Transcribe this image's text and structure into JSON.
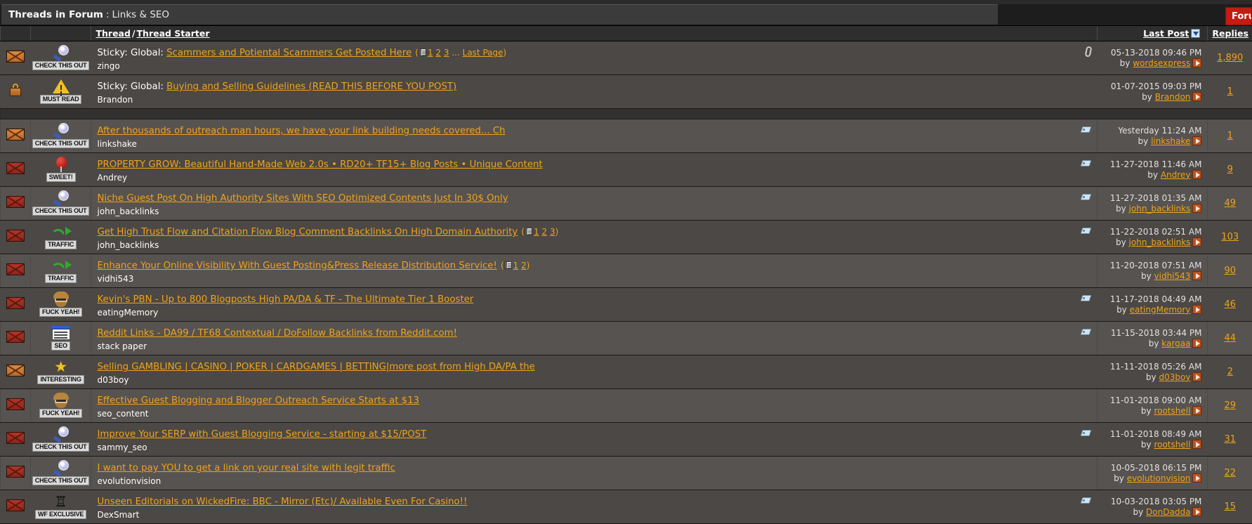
{
  "header": {
    "title_label": "Threads in Forum",
    "separator": ":",
    "forum_name": "Links & SEO",
    "forum_tools_label": "Forum Tools"
  },
  "columns": {
    "thread": "Thread",
    "slash": "/",
    "thread_starter": "Thread Starter",
    "last_post": "Last Post",
    "replies": "Replies"
  },
  "colors": {
    "link": "#f0a31a",
    "text": "#ffffff",
    "row_dark": "#4b4845",
    "row_light": "#565350",
    "header_bar": "#3b3b3b",
    "accent_button": "#c41b12"
  },
  "sticky_rows": [
    {
      "status_icon": "unread-envelope-orange-icon",
      "prefix_icon": "magnifier-icon",
      "prefix_caption": "CHECK THIS OUT",
      "sticky_label": "Sticky: Global:",
      "title": "Scammers and Potiental Scammers Get Posted Here",
      "pages": [
        "1",
        "2",
        "3"
      ],
      "pages_ellipsis": "...",
      "last_page_label": "Last Page",
      "starter": "zingo",
      "has_attachment": true,
      "has_tag": false,
      "last_post_date": "05-13-2018 09:46 PM",
      "last_post_by_prefix": "by",
      "last_post_by": "wordsexpress",
      "replies": "1,890",
      "shade": "dark"
    },
    {
      "status_icon": "locked-envelope-icon",
      "prefix_icon": "warning-triangle-icon",
      "prefix_caption": "MUST READ",
      "sticky_label": "Sticky: Global:",
      "title": "Buying and Selling Guidelines (READ THIS BEFORE YOU POST)",
      "pages": [],
      "pages_ellipsis": "",
      "last_page_label": "",
      "starter": "Brandon",
      "has_attachment": false,
      "has_tag": false,
      "last_post_date": "01-07-2015 09:03 PM",
      "last_post_by_prefix": "by",
      "last_post_by": "Brandon",
      "replies": "1",
      "shade": "dark"
    }
  ],
  "thread_rows": [
    {
      "status_icon": "unread-envelope-orange-icon",
      "prefix_icon": "magnifier-icon",
      "prefix_caption": "CHECK THIS OUT",
      "title": "After thousands of outreach man hours, we have your link building needs covered... Ch",
      "pages": [],
      "starter": "linkshake",
      "has_tag": true,
      "last_post_date": "Yesterday 11:24 AM",
      "last_post_by_prefix": "by",
      "last_post_by": "linkshake",
      "replies": "1",
      "shade": "light"
    },
    {
      "status_icon": "unread-envelope-red-icon",
      "prefix_icon": "lollipop-icon",
      "prefix_caption": "SWEET!",
      "title": "PROPERTY GROW: Beautiful Hand-Made Web 2.0s • RD20+ TF15+ Blog Posts • Unique Content",
      "pages": [],
      "starter": "Andrey",
      "has_tag": true,
      "last_post_date": "11-27-2018 11:46 AM",
      "last_post_by_prefix": "by",
      "last_post_by": "Andrey",
      "replies": "9",
      "shade": "dark"
    },
    {
      "status_icon": "unread-envelope-red-icon",
      "prefix_icon": "magnifier-icon",
      "prefix_caption": "CHECK THIS OUT",
      "title": "Niche Guest Post On High Authority Sites With SEO Optimized Contents Just In 30$ Only",
      "pages": [],
      "starter": "john_backlinks",
      "has_tag": true,
      "last_post_date": "11-27-2018 01:35 AM",
      "last_post_by_prefix": "by",
      "last_post_by": "john_backlinks",
      "replies": "49",
      "shade": "light"
    },
    {
      "status_icon": "unread-envelope-red-icon",
      "prefix_icon": "traffic-arrow-icon",
      "prefix_caption": "TRAFFIC",
      "title": "Get High Trust Flow and Citation Flow Blog Comment Backlinks On High Domain Authority",
      "pages": [
        "1",
        "2",
        "3"
      ],
      "starter": "john_backlinks",
      "has_tag": true,
      "last_post_date": "11-22-2018 02:51 AM",
      "last_post_by_prefix": "by",
      "last_post_by": "john_backlinks",
      "replies": "103",
      "shade": "dark"
    },
    {
      "status_icon": "unread-envelope-red-icon",
      "prefix_icon": "traffic-arrow-icon",
      "prefix_caption": "TRAFFIC",
      "title": "Enhance Your Online Visibility With Guest Posting&Press Release Distribution Service!",
      "pages": [
        "1",
        "2"
      ],
      "starter": "vidhi543",
      "has_tag": false,
      "last_post_date": "11-20-2018 07:51 AM",
      "last_post_by_prefix": "by",
      "last_post_by": "vidhi543",
      "replies": "90",
      "shade": "light"
    },
    {
      "status_icon": "unread-envelope-red-icon",
      "prefix_icon": "bearded-face-icon",
      "prefix_caption": "FUCK YEAH!",
      "title": "Kevin's PBN - Up to 800 Blogposts High PA/DA & TF - The Ultimate Tier 1 Booster",
      "pages": [],
      "starter": "eatingMemory",
      "has_tag": true,
      "last_post_date": "11-17-2018 04:49 AM",
      "last_post_by_prefix": "by",
      "last_post_by": "eatingMemory",
      "replies": "46",
      "shade": "dark"
    },
    {
      "status_icon": "unread-envelope-red-icon",
      "prefix_icon": "browser-window-icon",
      "prefix_caption": "SEO",
      "title": "Reddit Links - DA99 / TF68 Contextual / DoFollow Backlinks from Reddit.com!",
      "pages": [],
      "starter": "stack paper",
      "has_tag": true,
      "last_post_date": "11-15-2018 03:44 PM",
      "last_post_by_prefix": "by",
      "last_post_by": "kargaa",
      "replies": "44",
      "shade": "light"
    },
    {
      "status_icon": "unread-envelope-orange-icon",
      "prefix_icon": "star-icon",
      "prefix_caption": "INTERESTING",
      "title": "Selling GAMBLING | CASINO | POKER | CARDGAMES | BETTING|more post from High DA/PA the",
      "pages": [],
      "starter": "d03boy",
      "has_tag": false,
      "last_post_date": "11-11-2018 05:26 AM",
      "last_post_by_prefix": "by",
      "last_post_by": "d03boy",
      "replies": "2",
      "shade": "dark"
    },
    {
      "status_icon": "unread-envelope-red-icon",
      "prefix_icon": "bearded-face-icon",
      "prefix_caption": "FUCK YEAH!",
      "title": "Effective Guest Blogging and Blogger Outreach Service Starts at $13",
      "pages": [],
      "starter": "seo_content",
      "has_tag": false,
      "last_post_date": "11-01-2018 09:00 AM",
      "last_post_by_prefix": "by",
      "last_post_by": "rootshell",
      "replies": "29",
      "shade": "light"
    },
    {
      "status_icon": "unread-envelope-red-icon",
      "prefix_icon": "magnifier-icon",
      "prefix_caption": "CHECK THIS OUT",
      "title": "Improve Your SERP with Guest Blogging Service - starting at $15/POST",
      "pages": [],
      "starter": "sammy_seo",
      "has_tag": true,
      "last_post_date": "11-01-2018 08:49 AM",
      "last_post_by_prefix": "by",
      "last_post_by": "rootshell",
      "replies": "31",
      "shade": "dark"
    },
    {
      "status_icon": "unread-envelope-red-icon",
      "prefix_icon": "magnifier-icon",
      "prefix_caption": "CHECK THIS OUT",
      "title": "I want to pay YOU to get a link on your real site with legit traffic",
      "pages": [],
      "starter": "evolutionvision",
      "has_tag": false,
      "last_post_date": "10-05-2018 06:15 PM",
      "last_post_by_prefix": "by",
      "last_post_by": "evolutionvision",
      "replies": "22",
      "shade": "light"
    },
    {
      "status_icon": "unread-envelope-red-icon",
      "prefix_icon": "wf-wings-icon",
      "prefix_caption": "WF EXCLUSIVE",
      "title": "Unseen Editorials on WickedFire: BBC - Mirror (Etc)/ Available Even For Casino!!",
      "pages": [],
      "starter": "DexSmart",
      "has_tag": true,
      "last_post_date": "10-03-2018 03:05 PM",
      "last_post_by_prefix": "by",
      "last_post_by": "DonDadda",
      "replies": "15",
      "shade": "dark"
    }
  ]
}
